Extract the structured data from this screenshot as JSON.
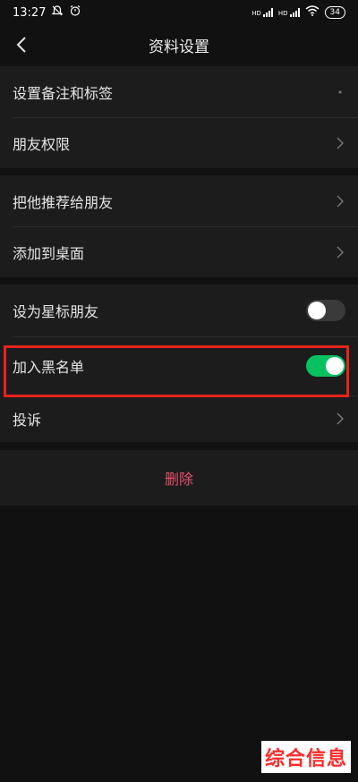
{
  "status": {
    "time": "13:27",
    "battery": "34",
    "hd1": "HD",
    "hd2": "HD"
  },
  "nav": {
    "title": "资料设置"
  },
  "groups": {
    "g1": [
      "设置备注和标签",
      "朋友权限"
    ],
    "g2": [
      "把他推荐给朋友",
      "添加到桌面"
    ],
    "g3": {
      "star": "设为星标朋友",
      "blacklist": "加入黑名单",
      "report": "投诉"
    }
  },
  "toggles": {
    "star_on": false,
    "blacklist_on": true
  },
  "colors": {
    "accent_green": "#07c160",
    "highlight_red": "#e8231b",
    "delete_red": "#e8506a"
  },
  "delete_label": "删除",
  "watermark": "综合信息"
}
